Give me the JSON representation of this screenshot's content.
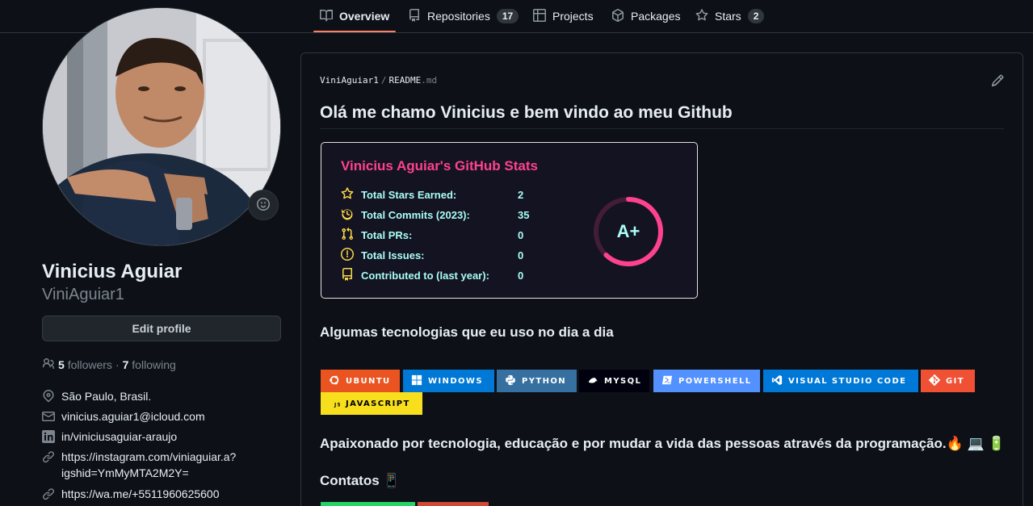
{
  "nav": {
    "tabs": [
      {
        "label": "Overview",
        "icon": "book-icon"
      },
      {
        "label": "Repositories",
        "count": "17",
        "icon": "repo-icon"
      },
      {
        "label": "Projects",
        "icon": "table-icon"
      },
      {
        "label": "Packages",
        "icon": "package-icon"
      },
      {
        "label": "Stars",
        "count": "2",
        "icon": "star-icon"
      }
    ]
  },
  "profile": {
    "name": "Vinicius Aguiar",
    "login": "ViniAguiar1",
    "edit_label": "Edit profile",
    "followers_count": "5",
    "followers_label": "followers",
    "dot": "·",
    "following_count": "7",
    "following_label": "following",
    "location": "São Paulo, Brasil.",
    "email": "vinicius.aguiar1@icloud.com",
    "linkedin": "in/viniciusaguiar-araujo",
    "instagram_line1": "https://instagram.com/viniaguiar.a?",
    "instagram_line2": "igshid=YmMyMTA2M2Y=",
    "whatsapp": "https://wa.me/+5511960625600"
  },
  "readme": {
    "owner": "ViniAguiar1",
    "separator": "/",
    "file": "README",
    "ext": ".md",
    "heading": "Olá me chamo Vinicius e bem vindo ao meu Github",
    "stats": {
      "title": "Vinicius Aguiar's GitHub Stats",
      "rows": [
        {
          "label": "Total Stars Earned:",
          "value": "2",
          "icon": "star-icon"
        },
        {
          "label": "Total Commits (2023):",
          "value": "35",
          "icon": "history-icon"
        },
        {
          "label": "Total PRs:",
          "value": "0",
          "icon": "pull-request-icon"
        },
        {
          "label": "Total Issues:",
          "value": "0",
          "icon": "issue-icon"
        },
        {
          "label": "Contributed to (last year):",
          "value": "0",
          "icon": "repo-icon"
        }
      ],
      "rank": "A+",
      "rank_progress": 0.62,
      "colors": {
        "title": "#fe428e",
        "text": "#a9fef7",
        "icon": "#f8d847",
        "bg": "#141321"
      }
    },
    "tech_heading": "Algumas tecnologias que eu uso no dia a dia",
    "badges": [
      {
        "label": "UBUNTU",
        "color": "#e95420",
        "icon": "ubuntu-icon"
      },
      {
        "label": "WINDOWS",
        "color": "#0078d6",
        "icon": "windows-icon"
      },
      {
        "label": "PYTHON",
        "color": "#3670a0",
        "icon": "python-icon"
      },
      {
        "label": "MYSQL",
        "color": "#00000f",
        "icon": "mysql-icon"
      },
      {
        "label": "POWERSHELL",
        "color": "#5391fe",
        "icon": "powershell-icon"
      },
      {
        "label": "VISUAL STUDIO CODE",
        "color": "#0078d7",
        "icon": "vscode-icon"
      },
      {
        "label": "GIT",
        "color": "#f05033",
        "icon": "git-icon"
      },
      {
        "label": "JAVASCRIPT",
        "color": "#f7df1e",
        "icon": "javascript-icon"
      }
    ],
    "passion_text": "Apaixonado por tecnologia, educação e por mudar a vida das pessoas através da programação.🔥 💻 🔋",
    "contacts_heading": "Contatos 📱"
  }
}
